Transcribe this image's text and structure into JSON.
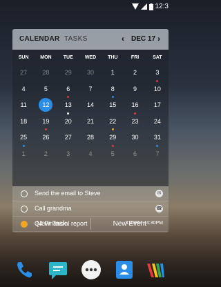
{
  "status": {
    "time": "12:3"
  },
  "widget": {
    "tab_calendar": "CALENDAR",
    "tab_tasks": "TASKS",
    "prev": "‹",
    "next": "›",
    "month": "DEC 17",
    "weekdays": [
      "SUN",
      "MON",
      "TUE",
      "WED",
      "THU",
      "FRI",
      "SAT"
    ],
    "weeks": [
      [
        {
          "d": "27",
          "dim": true
        },
        {
          "d": "28",
          "dim": true
        },
        {
          "d": "29",
          "dim": true
        },
        {
          "d": "30",
          "dim": true
        },
        {
          "d": "1"
        },
        {
          "d": "2"
        },
        {
          "d": "3",
          "dot": "#e83a3a"
        }
      ],
      [
        {
          "d": "4"
        },
        {
          "d": "5"
        },
        {
          "d": "6",
          "dot": "#e83a3a"
        },
        {
          "d": "7"
        },
        {
          "d": "8",
          "dot": "#2a8ee8"
        },
        {
          "d": "9"
        },
        {
          "d": "10"
        }
      ],
      [
        {
          "d": "11"
        },
        {
          "d": "12",
          "today": true
        },
        {
          "d": "13",
          "dot": "#ffffff"
        },
        {
          "d": "14"
        },
        {
          "d": "15"
        },
        {
          "d": "16",
          "dot": "#e83a3a"
        },
        {
          "d": "17"
        }
      ],
      [
        {
          "d": "18"
        },
        {
          "d": "19",
          "dot": "#e83a3a"
        },
        {
          "d": "20"
        },
        {
          "d": "21"
        },
        {
          "d": "22",
          "dot": "#f5a623"
        },
        {
          "d": "23"
        },
        {
          "d": "24"
        }
      ],
      [
        {
          "d": "25",
          "dot": "#2a8ee8"
        },
        {
          "d": "26"
        },
        {
          "d": "27"
        },
        {
          "d": "28"
        },
        {
          "d": "29",
          "dot": "#e83a3a"
        },
        {
          "d": "30"
        },
        {
          "d": "31",
          "dot": "#2a8ee8"
        }
      ],
      [
        {
          "d": "1",
          "dim": true
        },
        {
          "d": "2",
          "dim": true
        },
        {
          "d": "3",
          "dim": true
        },
        {
          "d": "4",
          "dim": true
        },
        {
          "d": "5",
          "dim": true
        },
        {
          "d": "6",
          "dim": true
        },
        {
          "d": "7",
          "dim": true
        }
      ]
    ],
    "tasks": [
      {
        "label": "Send the email to Steve",
        "icon": "email-icon",
        "filled": false
      },
      {
        "label": "Call grandma",
        "icon": "phone-icon",
        "filled": false
      },
      {
        "label": "Q4 Financial report",
        "time": "3:30PM - 4:30PM",
        "filled": true,
        "color": "#f5a623"
      }
    ],
    "new_task": "New Task",
    "new_event": "New Event"
  },
  "dock": [
    "phone-app-icon",
    "messenger-app-icon",
    "app-drawer-icon",
    "contacts-app-icon",
    "photos-app-icon"
  ],
  "colors": {
    "accent": "#2a8ee8",
    "event_red": "#e83a3a",
    "event_orange": "#f5a623"
  }
}
